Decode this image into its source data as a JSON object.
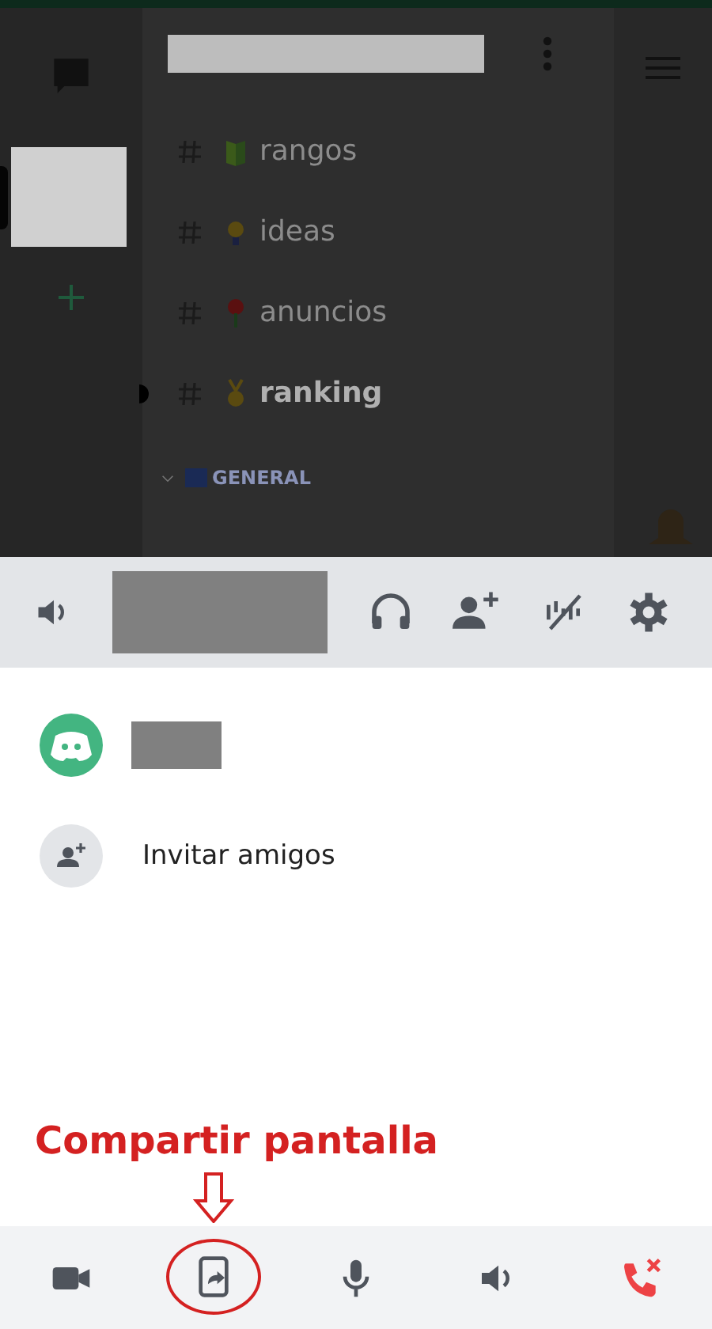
{
  "channels": [
    {
      "name": "rangos",
      "unread": false,
      "kind": "leaf"
    },
    {
      "name": "ideas",
      "unread": false,
      "kind": "bulb"
    },
    {
      "name": "anuncios",
      "unread": false,
      "kind": "pin"
    },
    {
      "name": "ranking",
      "unread": true,
      "kind": "medal"
    }
  ],
  "category": "GENERAL",
  "members": [
    {
      "kind": "user"
    },
    {
      "kind": "invite",
      "label": "Invitar amigos"
    }
  ],
  "annotation": "Compartir pantalla",
  "controls": [
    {
      "kind": "camera",
      "highlighted": false
    },
    {
      "kind": "share",
      "highlighted": true
    },
    {
      "kind": "mic",
      "highlighted": false
    },
    {
      "kind": "speaker",
      "highlighted": false
    },
    {
      "kind": "hangup",
      "highlighted": false
    }
  ]
}
